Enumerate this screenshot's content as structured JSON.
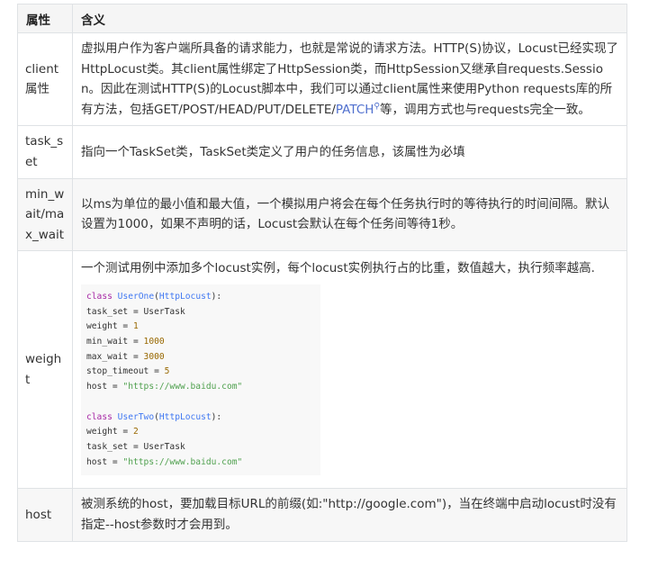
{
  "header": {
    "col1": "属性",
    "col2": "含义"
  },
  "rows": [
    {
      "attr": "client属性",
      "desc_before": "虚拟用户作为客户端所具备的请求能力，也就是常说的请求方法。HTTP(S)协议，Locust已经实现了HttpLocust类。其client属性绑定了HttpSession类，而HttpSession又继承自requests.Session。因此在测试HTTP(S)的Locust脚本中，我们可以通过client属性来使用Python requests库的所有方法，包括GET/POST/HEAD/PUT/DELETE/",
      "desc_link": "PATCH",
      "desc_after": "等，调用方式也与requests完全一致。"
    },
    {
      "attr": "task_set",
      "desc": "指向一个TaskSet类，TaskSet类定义了用户的任务信息，该属性为必填"
    },
    {
      "attr": "min_wait/max_wait",
      "desc": "以ms为单位的最小值和最大值，一个模拟用户将会在每个任务执行时的等待执行的时间间隔。默认设置为1000，如果不声明的话，Locust会默认在每个任务间等待1秒。"
    },
    {
      "attr": "weight",
      "desc": "一个测试用例中添加多个locust实例，每个locust实例执行占的比重，数值越大，执行频率越高.",
      "code": {
        "kw_class": "class",
        "c1_name": "UserOne",
        "c1_base": "HttpLocust",
        "c1_task_set": "task_set = UserTask",
        "c1_weight_key": "weight = ",
        "c1_weight_val": "1",
        "c1_min_key": "min_wait = ",
        "c1_min_val": "1000",
        "c1_max_key": "max_wait = ",
        "c1_max_val": "3000",
        "c1_stop_key": "stop_timeout = ",
        "c1_stop_val": "5",
        "c1_host_key": "host = ",
        "c1_host_val": "\"https://www.baidu.com\"",
        "c2_name": "UserTwo",
        "c2_base": "HttpLocust",
        "c2_weight_key": "weight = ",
        "c2_weight_val": "2",
        "c2_task_set": "task_set = UserTask",
        "c2_host_key": "host = ",
        "c2_host_val": "\"https://www.baidu.com\""
      }
    },
    {
      "attr": "host",
      "desc": "被测系统的host，要加载目标URL的前缀(如:\"http://google.com\")，当在终端中启动locust时没有指定--host参数时才会用到。"
    }
  ]
}
